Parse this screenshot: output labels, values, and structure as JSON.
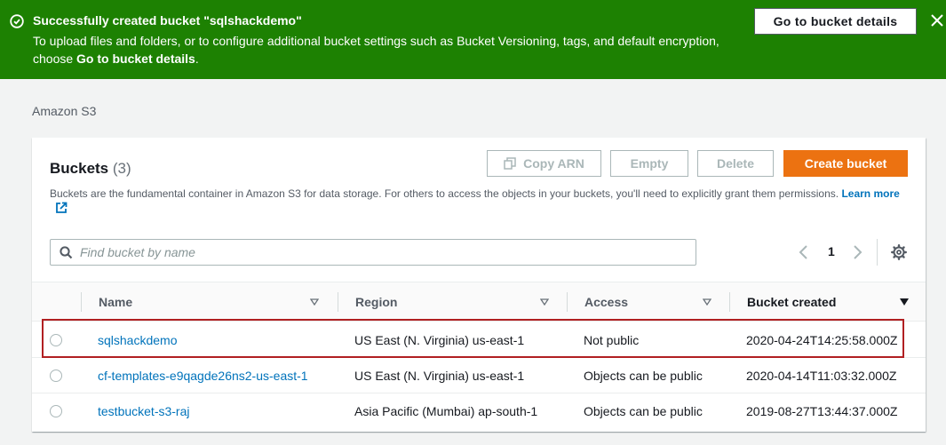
{
  "flash": {
    "title": "Successfully created bucket \"sqlshackdemo\"",
    "body_line1": "To upload files and folders, or to configure additional bucket settings such as Bucket Versioning, tags, and default encryption,",
    "body_line2_prefix": "choose ",
    "body_line2_bold": "Go to bucket details",
    "body_line2_suffix": ".",
    "button_label": "Go to bucket details",
    "color": "#1d8102"
  },
  "breadcrumb": "Amazon S3",
  "buckets_panel": {
    "title": "Buckets",
    "count": "(3)",
    "description": "Buckets are the fundamental container in Amazon S3 for data storage. For others to access the objects in your buckets, you'll need to explicitly grant them permissions.",
    "learn_more": "Learn more",
    "buttons": {
      "copy_arn": "Copy ARN",
      "empty": "Empty",
      "delete": "Delete",
      "create": "Create bucket"
    },
    "search_placeholder": "Find bucket by name",
    "page_number": "1",
    "columns": [
      "Name",
      "Region",
      "Access",
      "Bucket created"
    ],
    "rows": [
      {
        "name": "sqlshackdemo",
        "region": "US East (N. Virginia) us-east-1",
        "access": "Not public",
        "created": "2020-04-24T14:25:58.000Z"
      },
      {
        "name": "cf-templates-e9qagde26ns2-us-east-1",
        "region": "US East (N. Virginia) us-east-1",
        "access": "Objects can be public",
        "created": "2020-04-14T11:03:32.000Z"
      },
      {
        "name": "testbucket-s3-raj",
        "region": "Asia Pacific (Mumbai) ap-south-1",
        "access": "Objects can be public",
        "created": "2019-08-27T13:44:37.000Z"
      }
    ]
  },
  "colors": {
    "accent": "#ec7211",
    "link": "#0073bb",
    "highlight": "#b12022"
  }
}
